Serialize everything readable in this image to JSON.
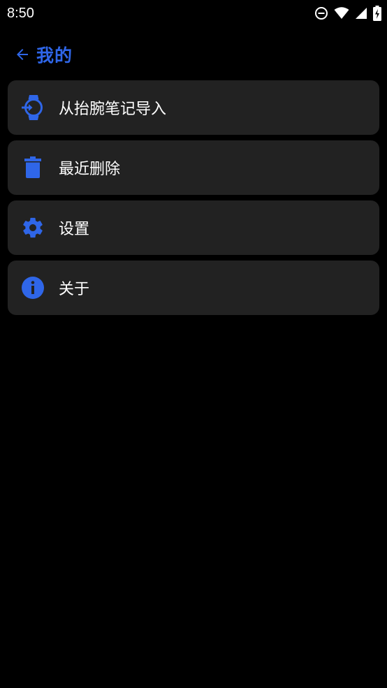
{
  "status_bar": {
    "time": "8:50",
    "icons": [
      "do-not-disturb-icon",
      "wifi-icon",
      "cellular-signal-icon",
      "battery-charging-icon"
    ]
  },
  "header": {
    "back_icon": "arrow-left-icon",
    "title": "我的"
  },
  "menu": {
    "items": [
      {
        "icon": "watch-import-icon",
        "label": "从抬腕笔记导入"
      },
      {
        "icon": "trash-icon",
        "label": "最近删除"
      },
      {
        "icon": "gear-icon",
        "label": "设置"
      },
      {
        "icon": "info-icon",
        "label": "关于"
      }
    ]
  },
  "colors": {
    "accent": "#2f66e8",
    "background": "#000000",
    "card": "#222222",
    "text": "#ffffff"
  }
}
